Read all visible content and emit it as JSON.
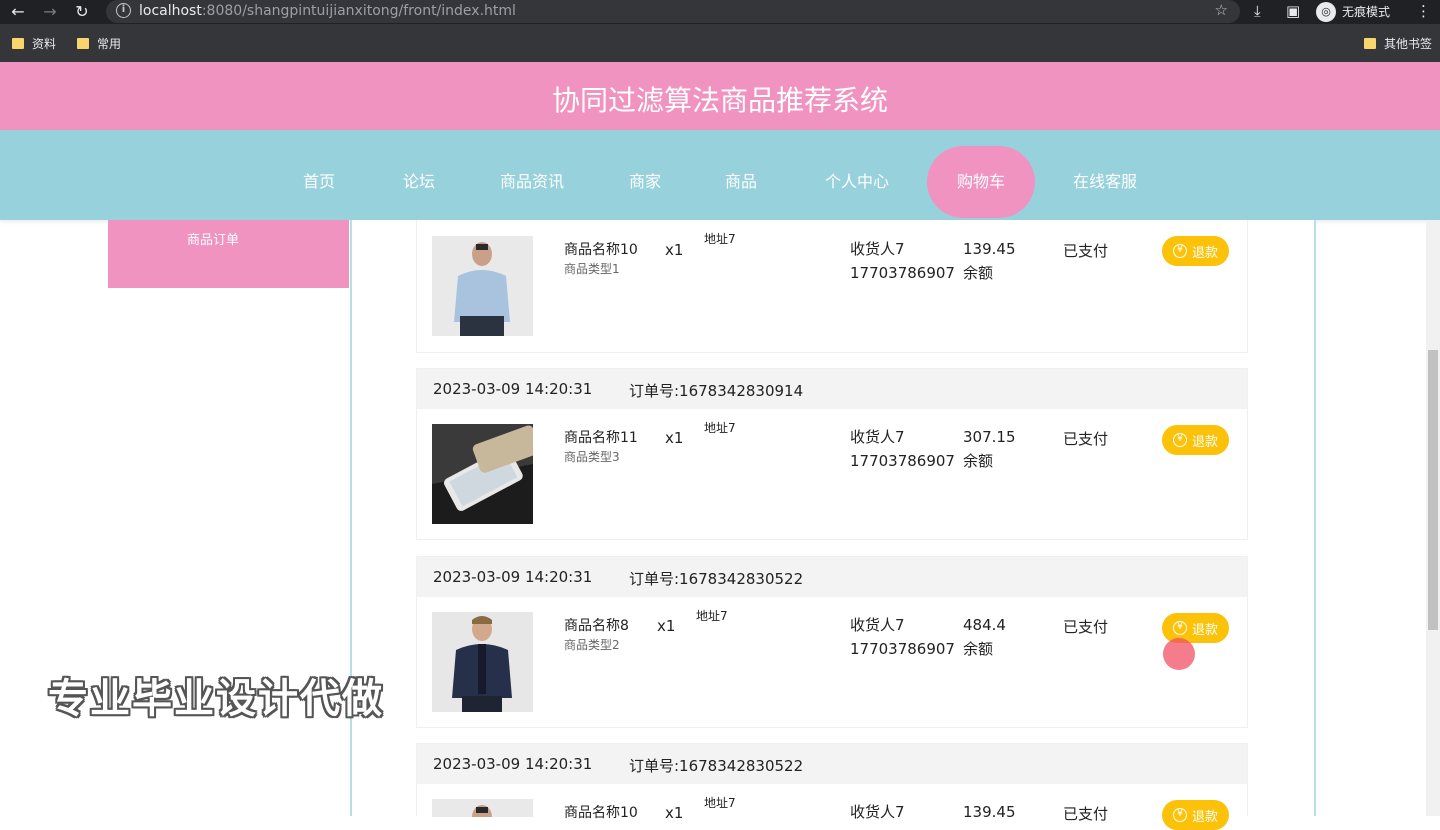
{
  "browser": {
    "url_host": "localhost",
    "url_rest": ":8080/shangpintuijianxitong/front/index.html",
    "incognito_label": "无痕模式",
    "bookmarks": [
      "资料",
      "常用"
    ],
    "other_bookmarks": "其他书签"
  },
  "site": {
    "title": "协同过滤算法商品推荐系统",
    "nav": [
      "首页",
      "论坛",
      "商品资讯",
      "商家",
      "商品",
      "个人中心",
      "购物车",
      "在线客服"
    ],
    "active_nav": "购物车"
  },
  "sidebar": {
    "items": [
      "商品订单"
    ]
  },
  "orders": [
    {
      "date": "",
      "order_no": "",
      "product_name": "商品名称10",
      "product_type": "商品类型1",
      "qty": "x1",
      "address": "地址7",
      "receiver": "收货人7",
      "phone": "17703786907",
      "price": "139.45",
      "pay_method": "余额",
      "status": "已支付",
      "action": "退款",
      "image": "man-light-blue-shirt"
    },
    {
      "date": "2023-03-09 14:20:31",
      "order_no": "订单号:1678342830914",
      "product_name": "商品名称11",
      "product_type": "商品类型3",
      "qty": "x1",
      "address": "地址7",
      "receiver": "收货人7",
      "phone": "17703786907",
      "price": "307.15",
      "pay_method": "余额",
      "status": "已支付",
      "action": "退款",
      "image": "smartphone"
    },
    {
      "date": "2023-03-09 14:20:31",
      "order_no": "订单号:1678342830522",
      "product_name": "商品名称8",
      "product_type": "商品类型2",
      "qty": "x1",
      "address": "地址7",
      "receiver": "收货人7",
      "phone": "17703786907",
      "price": "484.4",
      "pay_method": "余额",
      "status": "已支付",
      "action": "退款",
      "image": "man-navy-jacket"
    },
    {
      "date": "2023-03-09 14:20:31",
      "order_no": "订单号:1678342830522",
      "product_name": "商品名称10",
      "product_type": "",
      "qty": "x1",
      "address": "地址7",
      "receiver": "收货人7",
      "phone": "",
      "price": "139.45",
      "pay_method": "",
      "status": "已支付",
      "action": "退款",
      "image": "man-light-blue-shirt"
    }
  ],
  "watermark": "专业毕业设计代做",
  "colors": {
    "header": "#f093c1",
    "nav": "#97d2dc",
    "refund": "#fcc209"
  }
}
